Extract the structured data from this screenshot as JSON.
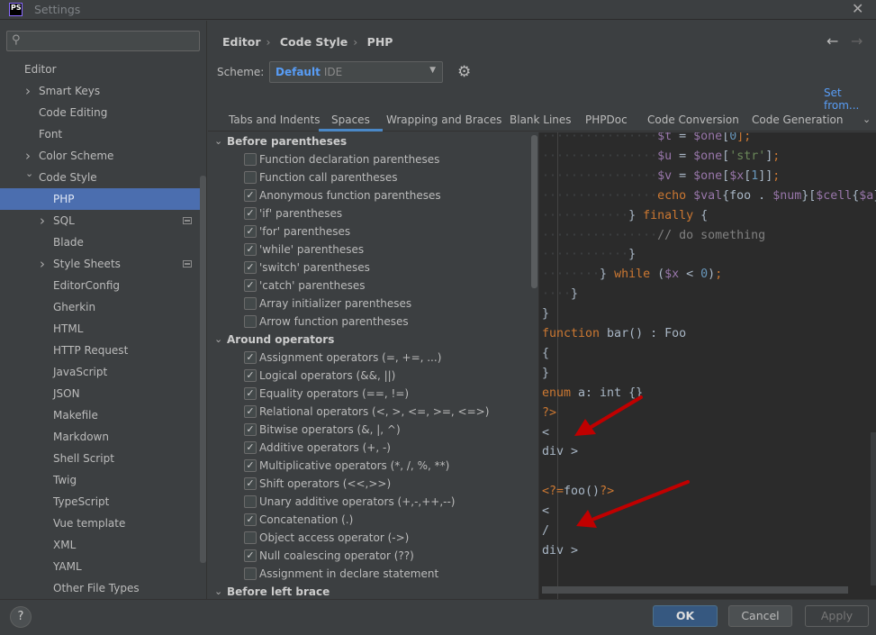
{
  "window": {
    "title": "Settings",
    "logo": "PS",
    "close_icon": "close-icon"
  },
  "sidebar": {
    "search_placeholder": "",
    "items": [
      {
        "label": "Editor",
        "level": 0,
        "bold": false
      },
      {
        "label": "Smart Keys",
        "level": 1,
        "chevron": "right"
      },
      {
        "label": "Code Editing",
        "level": 1
      },
      {
        "label": "Font",
        "level": 1
      },
      {
        "label": "Color Scheme",
        "level": 1,
        "chevron": "right"
      },
      {
        "label": "Code Style",
        "level": 1,
        "chevron": "down"
      },
      {
        "label": "PHP",
        "level": 2,
        "selected": true
      },
      {
        "label": "SQL",
        "level": 2,
        "chevron": "right",
        "modified": true
      },
      {
        "label": "Blade",
        "level": 2
      },
      {
        "label": "Style Sheets",
        "level": 2,
        "chevron": "right",
        "modified": true
      },
      {
        "label": "EditorConfig",
        "level": 2
      },
      {
        "label": "Gherkin",
        "level": 2
      },
      {
        "label": "HTML",
        "level": 2
      },
      {
        "label": "HTTP Request",
        "level": 2
      },
      {
        "label": "JavaScript",
        "level": 2
      },
      {
        "label": "JSON",
        "level": 2
      },
      {
        "label": "Makefile",
        "level": 2
      },
      {
        "label": "Markdown",
        "level": 2
      },
      {
        "label": "Shell Script",
        "level": 2
      },
      {
        "label": "Twig",
        "level": 2
      },
      {
        "label": "TypeScript",
        "level": 2
      },
      {
        "label": "Vue template",
        "level": 2
      },
      {
        "label": "XML",
        "level": 2
      },
      {
        "label": "YAML",
        "level": 2
      },
      {
        "label": "Other File Types",
        "level": 2
      }
    ]
  },
  "breadcrumb": [
    "Editor",
    "Code Style",
    "PHP"
  ],
  "scheme": {
    "label": "Scheme:",
    "name": "Default",
    "type": "IDE",
    "set_from": "Set from..."
  },
  "tabs": [
    {
      "label": "Tabs and Indents"
    },
    {
      "label": "Spaces",
      "active": true
    },
    {
      "label": "Wrapping and Braces"
    },
    {
      "label": "Blank Lines"
    },
    {
      "label": "PHPDoc"
    },
    {
      "label": "Code Conversion"
    },
    {
      "label": "Code Generation"
    }
  ],
  "options": [
    {
      "header": "Before parentheses"
    },
    {
      "label": "Function declaration parentheses",
      "checked": false
    },
    {
      "label": "Function call parentheses",
      "checked": false
    },
    {
      "label": "Anonymous function parentheses",
      "checked": true
    },
    {
      "label": "'if' parentheses",
      "checked": true
    },
    {
      "label": "'for' parentheses",
      "checked": true
    },
    {
      "label": "'while' parentheses",
      "checked": true
    },
    {
      "label": "'switch' parentheses",
      "checked": true
    },
    {
      "label": "'catch' parentheses",
      "checked": true
    },
    {
      "label": "Array initializer parentheses",
      "checked": false
    },
    {
      "label": "Arrow function parentheses",
      "checked": false
    },
    {
      "header": "Around operators"
    },
    {
      "label": "Assignment operators (=, +=, ...)",
      "checked": true
    },
    {
      "label": "Logical operators (&&, ||)",
      "checked": true
    },
    {
      "label": "Equality operators (==, !=)",
      "checked": true
    },
    {
      "label": "Relational operators (<, >, <=, >=, <=>)",
      "checked": true
    },
    {
      "label": "Bitwise operators (&, |, ^)",
      "checked": true
    },
    {
      "label": "Additive operators (+, -)",
      "checked": true
    },
    {
      "label": "Multiplicative operators (*, /, %, **)",
      "checked": true
    },
    {
      "label": "Shift operators (<<,>>)",
      "checked": true
    },
    {
      "label": "Unary additive operators (+,-,++,--)",
      "checked": false
    },
    {
      "label": "Concatenation (.)",
      "checked": true
    },
    {
      "label": "Object access operator (->)",
      "checked": false
    },
    {
      "label": "Null coalescing operator (??)",
      "checked": true
    },
    {
      "label": "Assignment in declare statement",
      "checked": false
    },
    {
      "header": "Before left brace"
    }
  ],
  "code": [
    [
      [
        "                ",
        "ws"
      ],
      [
        "$t",
        "var"
      ],
      [
        " = ",
        ""
      ],
      [
        "$one",
        "var"
      ],
      [
        "[",
        ""
      ],
      [
        "0",
        "num"
      ],
      [
        "];",
        "kw"
      ]
    ],
    [
      [
        "                ",
        "ws"
      ],
      [
        "$u",
        "var"
      ],
      [
        " = ",
        ""
      ],
      [
        "$one",
        "var"
      ],
      [
        "[",
        ""
      ],
      [
        "'str'",
        "str"
      ],
      [
        "]",
        ""
      ],
      [
        ";",
        "kw"
      ]
    ],
    [
      [
        "                ",
        "ws"
      ],
      [
        "$v",
        "var"
      ],
      [
        " = ",
        ""
      ],
      [
        "$one",
        "var"
      ],
      [
        "[",
        ""
      ],
      [
        "$x",
        "var"
      ],
      [
        "[",
        ""
      ],
      [
        "1",
        "num"
      ],
      [
        "]]",
        ""
      ],
      [
        ";",
        "kw"
      ]
    ],
    [
      [
        "                ",
        "ws"
      ],
      [
        "echo ",
        "kw"
      ],
      [
        "$val",
        "var"
      ],
      [
        "{foo . ",
        ""
      ],
      [
        "$num",
        "var"
      ],
      [
        "}[",
        ""
      ],
      [
        "$cell",
        "var"
      ],
      [
        "{",
        ""
      ],
      [
        "$a",
        "var"
      ],
      [
        "}",
        ""
      ]
    ],
    [
      [
        "            ",
        "ws"
      ],
      [
        "} ",
        ""
      ],
      [
        "finally",
        "kw"
      ],
      [
        " {",
        ""
      ]
    ],
    [
      [
        "                ",
        "ws"
      ],
      [
        "// do something",
        "cm"
      ]
    ],
    [
      [
        "            ",
        "ws"
      ],
      [
        "}",
        ""
      ]
    ],
    [
      [
        "        ",
        "ws"
      ],
      [
        "} ",
        ""
      ],
      [
        "while",
        "kw"
      ],
      [
        " (",
        ""
      ],
      [
        "$x",
        "var"
      ],
      [
        " < ",
        ""
      ],
      [
        "0",
        "num"
      ],
      [
        ")",
        ""
      ],
      [
        ";",
        "kw"
      ]
    ],
    [
      [
        "    ",
        "ws"
      ],
      [
        "}",
        ""
      ]
    ],
    [
      [
        "}",
        ""
      ]
    ],
    [
      [
        "function",
        "kw"
      ],
      [
        " bar() : Foo",
        ""
      ]
    ],
    [
      [
        "{",
        ""
      ]
    ],
    [
      [
        "}",
        ""
      ]
    ],
    [
      [
        "enum",
        "kw"
      ],
      [
        " a: int {}",
        ""
      ]
    ],
    [
      [
        "?>",
        "kw"
      ]
    ],
    [
      [
        "<",
        ""
      ]
    ],
    [
      [
        "div >",
        ""
      ]
    ],
    [],
    [
      [
        "<?=",
        "kw"
      ],
      [
        "foo()",
        ""
      ],
      [
        "?>",
        "kw"
      ]
    ],
    [
      [
        "<",
        ""
      ]
    ],
    [
      [
        "/",
        ""
      ]
    ],
    [
      [
        "div >",
        ""
      ]
    ]
  ],
  "colors": {
    "keyword": "#cc7832",
    "variable": "#9876aa",
    "string": "#6a8759",
    "number": "#6897bb",
    "comment": "#808080",
    "selection": "#4b6eaf",
    "annotation_arrow": "#c00000"
  },
  "footer": {
    "help": "?",
    "ok": "OK",
    "cancel": "Cancel",
    "apply": "Apply"
  }
}
